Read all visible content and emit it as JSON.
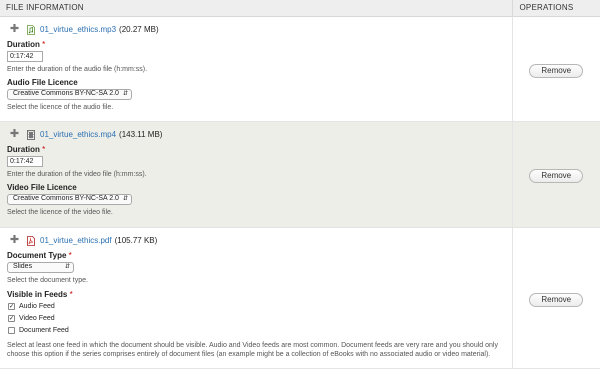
{
  "header": {
    "file_information": "FILE INFORMATION",
    "operations": "OPERATIONS"
  },
  "files": [
    {
      "icon": "audio-file-icon",
      "name": "01_virtue_ethics.mp3",
      "size": "(20.27 MB)",
      "duration_label": "Duration",
      "required_marker": "*",
      "duration_value": "0:17:42",
      "duration_desc": "Enter the duration of the audio file (h:mm:ss).",
      "licence_label": "Audio File Licence",
      "licence_value": "Creative Commons BY-NC-SA 2.0",
      "licence_desc": "Select the licence of the audio file.",
      "remove": "Remove"
    },
    {
      "icon": "video-file-icon",
      "name": "01_virtue_ethics.mp4",
      "size": "(143.11 MB)",
      "duration_label": "Duration",
      "required_marker": "*",
      "duration_value": "0:17:42",
      "duration_desc": "Enter the duration of the video file (h:mm:ss).",
      "licence_label": "Video File Licence",
      "licence_value": "Creative Commons BY-NC-SA 2.0",
      "licence_desc": "Select the licence of the video file.",
      "remove": "Remove"
    },
    {
      "icon": "pdf-file-icon",
      "name": "01_virtue_ethics.pdf",
      "size": "(105.77 KB)",
      "doctype_label": "Document Type",
      "required_marker": "*",
      "doctype_value": "Slides",
      "doctype_desc": "Select the document type.",
      "feeds_label": "Visible in Feeds",
      "feeds": [
        {
          "label": "Audio Feed",
          "checked": true
        },
        {
          "label": "Video Feed",
          "checked": true
        },
        {
          "label": "Document Feed",
          "checked": false
        }
      ],
      "feeds_desc": "Select at least one feed in which the document should be visible. Audio and Video feeds are most common. Document feeds are very rare and you should only choose this option if the series comprises entirely of document files (an example might be a collection of eBooks with no associated audio or video material).",
      "remove": "Remove"
    }
  ],
  "colors": {
    "link": "#2a6fb0",
    "required": "#cc0000",
    "alt_row": "#eeeee9"
  }
}
